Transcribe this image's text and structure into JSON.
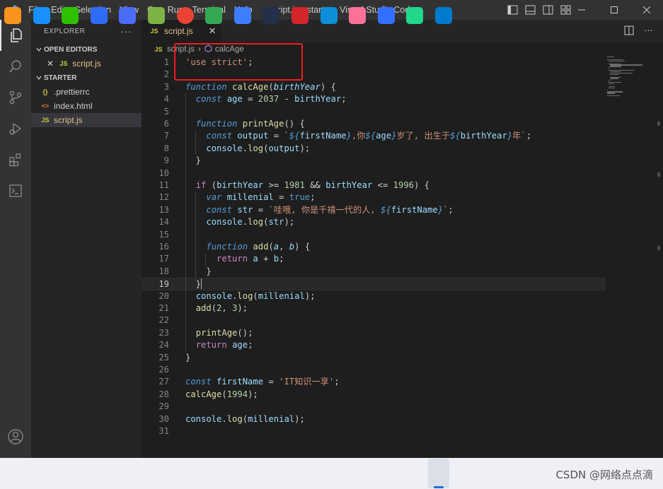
{
  "window": {
    "title": "script.js - starter - Visual Studio Code",
    "menu": [
      "File",
      "Edit",
      "Selection",
      "View",
      "Go",
      "Run",
      "Terminal",
      "Help"
    ]
  },
  "activity_bar": [
    "explorer-icon",
    "search-icon",
    "source-control-icon",
    "run-debug-icon",
    "extensions-icon",
    "remote-explorer-icon",
    "accounts-icon"
  ],
  "sidebar": {
    "title": "EXPLORER",
    "more": "···",
    "open_editors_label": "OPEN EDITORS",
    "open_editors": [
      {
        "icon": "JS",
        "name": "script.js"
      }
    ],
    "folder_label": "STARTER",
    "files": [
      {
        "icon": "{}",
        "name": ".prettierrc"
      },
      {
        "icon": "<>",
        "name": "index.html"
      },
      {
        "icon": "JS",
        "name": "script.js"
      }
    ]
  },
  "tab": {
    "icon": "JS",
    "label": "script.js",
    "close": "✕"
  },
  "breadcrumb": {
    "icon": "JS",
    "file": "script.js",
    "sep": "›",
    "symbol": "calcAge"
  },
  "editor": {
    "current_line": 19,
    "lines": [
      "'use strict';",
      "",
      "function calcAge(birthYear) {",
      "  const age = 2037 - birthYear;",
      "",
      "  function printAge() {",
      "    const output = `${firstName},你${age}岁了, 出生于${birthYear}年`;",
      "    console.log(output);",
      "  }",
      "",
      "  if (birthYear >= 1981 && birthYear <= 1996) {",
      "    var millenial = true;",
      "    const str = `哇哦, 你是千禧一代的人, ${firstName}`;",
      "    console.log(str);",
      "",
      "    function add(a, b) {",
      "      return a + b;",
      "    }",
      "  }",
      "  console.log(millenial);",
      "  add(2, 3);",
      "",
      "  printAge();",
      "  return age;",
      "}",
      "",
      "const firstName = 'IT知识一享';",
      "calcAge(1994);",
      "",
      "console.log(millenial);",
      ""
    ]
  },
  "taskbar": {
    "apps": [
      "fiddler",
      "dingtalk",
      "wechat",
      "lanhu",
      "qq-browser",
      "ai-app",
      "chrome",
      "gplayer",
      "music",
      "audio",
      "netease-music",
      "edge",
      "bilibili",
      "feishu",
      "pycharm",
      "vscode"
    ],
    "active": "vscode",
    "watermark": "CSDN @网络点点滴"
  },
  "colors": {
    "accent": "#007acc",
    "annotation": "#ee1c25"
  }
}
